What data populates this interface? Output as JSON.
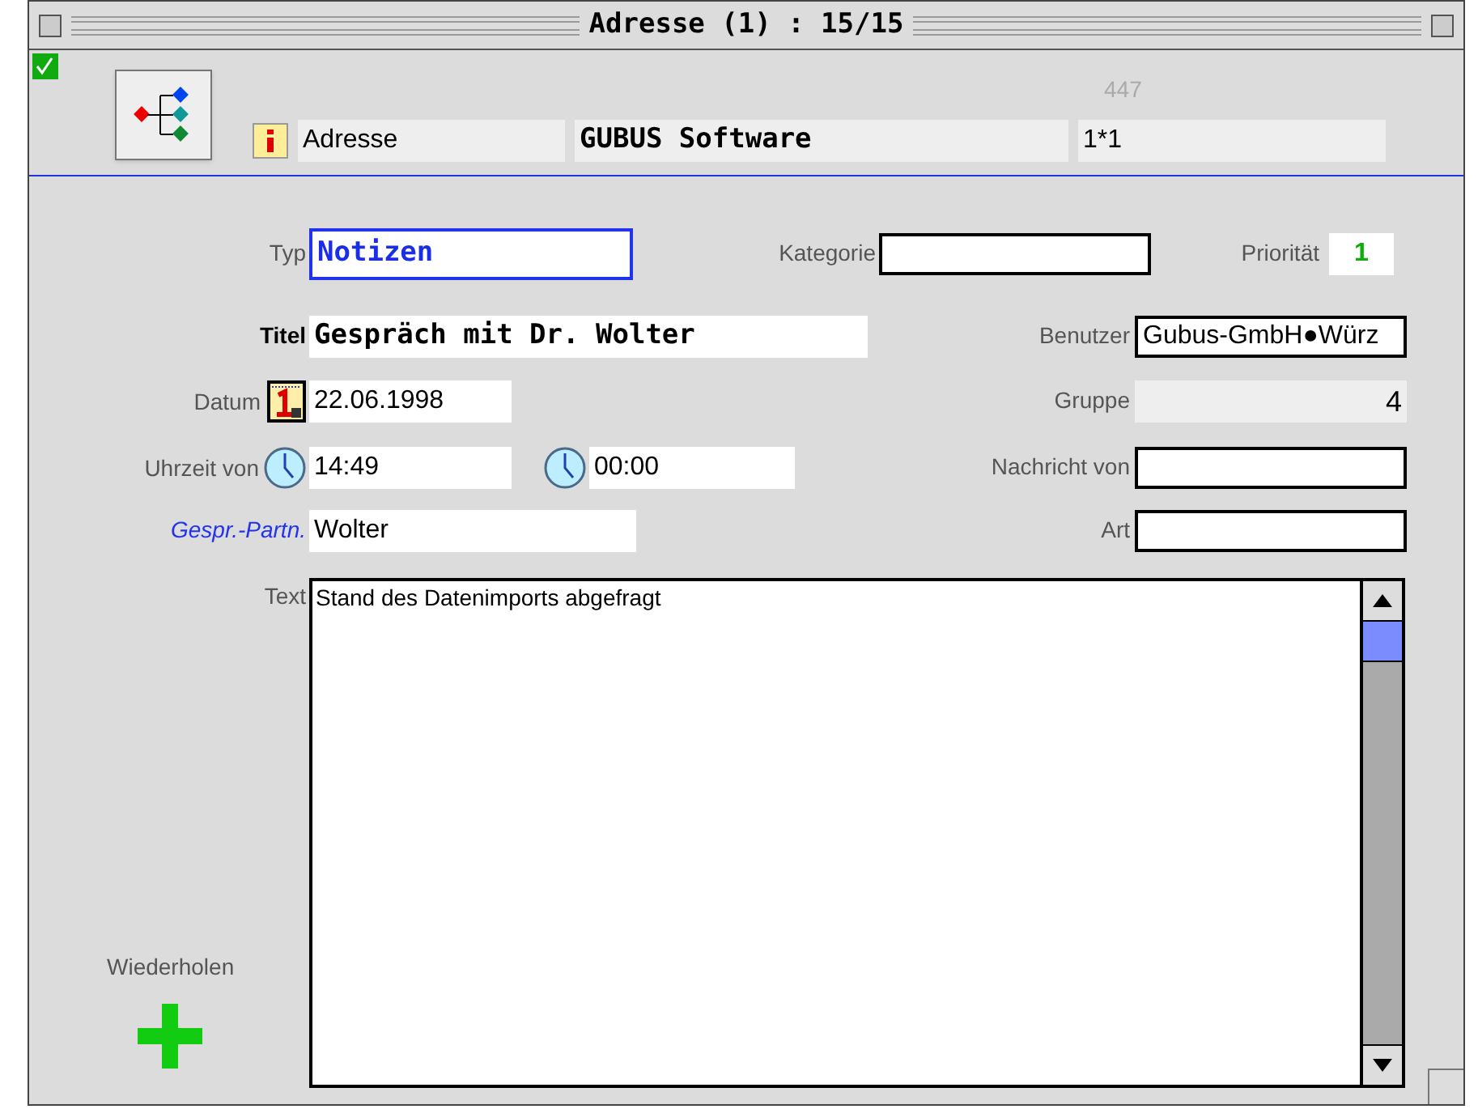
{
  "window": {
    "title": "Adresse (1) : 15/15"
  },
  "header": {
    "saved": true,
    "record_number": "447",
    "module": "Adresse",
    "company": "GUBUS Software",
    "code": "1*1"
  },
  "form": {
    "typ": {
      "label": "Typ",
      "value": "Notizen"
    },
    "kategorie": {
      "label": "Kategorie"
    },
    "prioritaet": {
      "label": "Priorität",
      "value": "1"
    },
    "titel": {
      "label": "Titel",
      "value": "Gespräch mit Dr. Wolter"
    },
    "benutzer": {
      "label": "Benutzer",
      "value": "Gubus-GmbH●Würz"
    },
    "datum": {
      "label": "Datum",
      "value": "22.06.1998"
    },
    "gruppe": {
      "label": "Gruppe",
      "value": "4"
    },
    "uhrzeit": {
      "label": "Uhrzeit von",
      "from": "14:49",
      "to": "00:00"
    },
    "nachricht": {
      "label": "Nachricht von"
    },
    "partner": {
      "label": "Gespr.-Partn.",
      "value": "Wolter"
    },
    "art": {
      "label": "Art"
    },
    "text": {
      "label": "Text",
      "value": "Stand des Datenimports abgefragt"
    },
    "repeat": {
      "label": "Wiederholen"
    }
  }
}
